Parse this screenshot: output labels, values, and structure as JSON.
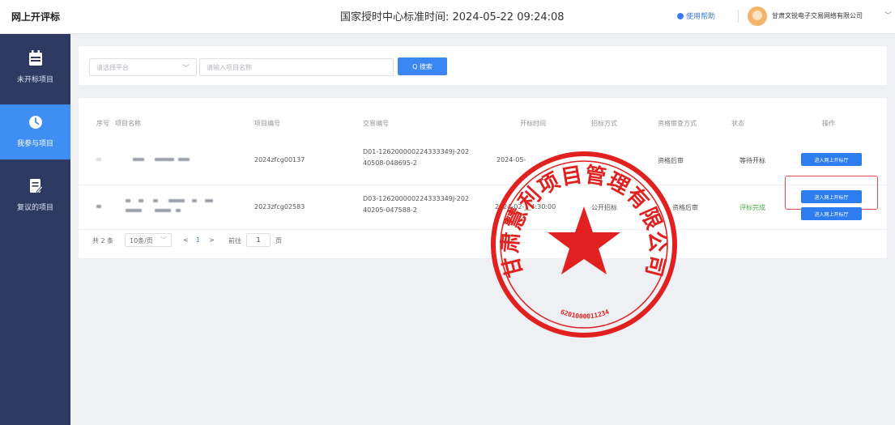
{
  "header": {
    "app_title": "网上开评标",
    "clock_label": "国家授时中心标准时间: 2024-05-22 09:24:08",
    "help_label": "使用帮助",
    "company_name": "甘肃文锐电子交易网络有限公司"
  },
  "sidebar": {
    "items": [
      {
        "label": "未开标项目",
        "icon": "calendar-icon",
        "active": false
      },
      {
        "label": "我参与项目",
        "icon": "clock-icon",
        "active": true
      },
      {
        "label": "复议的项目",
        "icon": "document-edit-icon",
        "active": false
      }
    ]
  },
  "search": {
    "platform_placeholder": "请选择平台",
    "name_placeholder": "请输入项目名称",
    "button_label": "Q 搜索"
  },
  "table": {
    "headers": [
      "序号",
      "项目名称",
      "项目编号",
      "交易编号",
      "开标时间",
      "招标方式",
      "资格审查方式",
      "状态",
      "操作"
    ],
    "rows": [
      {
        "project_no": "2024zfcg00137",
        "trade_no": "D01-126200000224333349J-202 40508-048695-2",
        "open_time": "2024-05-",
        "review": "资格后审",
        "status": "等待开标",
        "actions": [
          "进入网上开标厅"
        ]
      },
      {
        "project_no": "2023zfcg02583",
        "trade_no": "D03-126200000224333349J-202 40205-047588-2",
        "open_time": "2024-02-__4:30:00",
        "method": "公开招标",
        "review": "资格后审",
        "status": "评标完成",
        "actions": [
          "进入网上开标厅",
          "进入网上开标厅"
        ]
      }
    ]
  },
  "pager": {
    "total": "共 2 条",
    "page_size": "10条/页",
    "prev": "<",
    "current": "1",
    "next": ">",
    "goto_label": "前往",
    "goto_value": "1",
    "page_unit": "页"
  },
  "seal": {
    "text": "甘肃慧利项目管理有限公司",
    "number": "6201000011234",
    "color": "#e0211f"
  },
  "colors": {
    "sidebar_bg": "#2f3a63",
    "accent": "#3a86f3",
    "status_done": "#4cae4c",
    "highlight": "#e5484d"
  }
}
